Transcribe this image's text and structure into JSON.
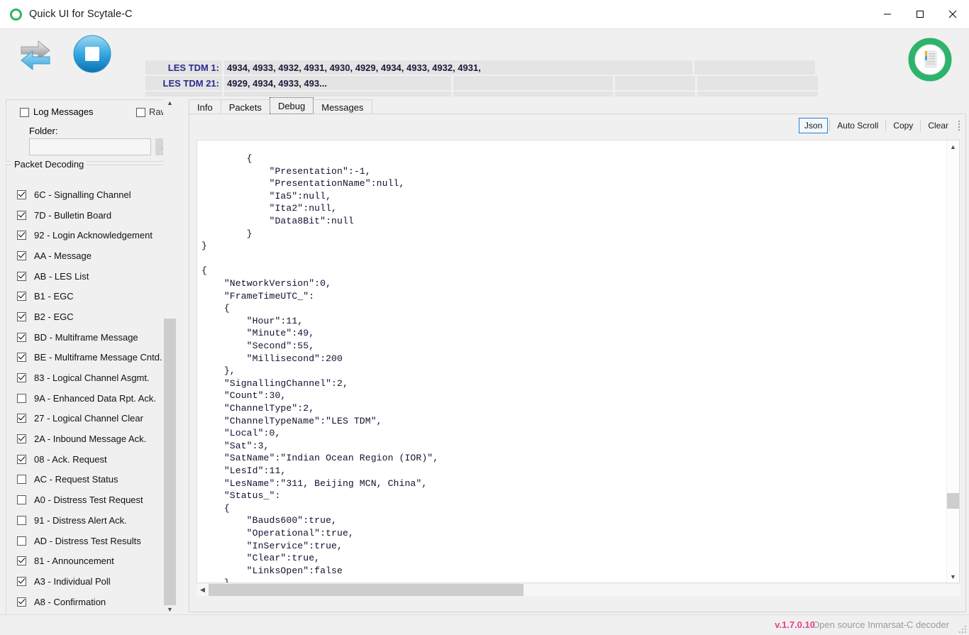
{
  "window": {
    "title": "Quick UI for Scytale-C",
    "logo_icon": "green-circle-icon",
    "minimize_label": "—",
    "maximize_label": "□",
    "close_label": "✕"
  },
  "toolbar": {
    "exchange_icon": "exchange-arrows-icon",
    "stop_icon": "stop-button-icon",
    "status_icon": "document-status-icon"
  },
  "status_grid": {
    "rows": [
      {
        "label": "LES TDM 1:",
        "value": "4934, 4933, 4932, 4931, 4930, 4929, 4934, 4933, 4932, 4931,"
      },
      {
        "label": "LES TDM 21:",
        "value": "4929, 4934, 4933, 493..."
      },
      {
        "label": "",
        "value": ""
      },
      {
        "label": "",
        "value": ""
      }
    ]
  },
  "left_panel": {
    "log_messages": {
      "label": "Log Messages",
      "checked": false
    },
    "raw": {
      "label": "Raw",
      "checked": false
    },
    "folder_label": "Folder:",
    "folder_value": "",
    "folder_placeholder": "",
    "browse_label": "...",
    "packet_decoding_title": "Packet Decoding",
    "packets": [
      {
        "label": "6C - Signalling Channel",
        "checked": true
      },
      {
        "label": "7D - Bulletin Board",
        "checked": true
      },
      {
        "label": "92 - Login Acknowledgement",
        "checked": true
      },
      {
        "label": "AA - Message",
        "checked": true
      },
      {
        "label": "AB - LES List",
        "checked": true
      },
      {
        "label": "B1 - EGC",
        "checked": true
      },
      {
        "label": "B2 - EGC",
        "checked": true
      },
      {
        "label": "BD - Multiframe Message",
        "checked": true
      },
      {
        "label": "BE - Multiframe Message Cntd.",
        "checked": true
      },
      {
        "label": "83 - Logical Channel Asgmt.",
        "checked": true
      },
      {
        "label": "9A - Enhanced Data Rpt. Ack.",
        "checked": false
      },
      {
        "label": "27 - Logical Channel Clear",
        "checked": true
      },
      {
        "label": "2A - Inbound Message Ack.",
        "checked": true
      },
      {
        "label": "08 - Ack. Request",
        "checked": true
      },
      {
        "label": "AC - Request Status",
        "checked": false
      },
      {
        "label": "A0 - Distress Test Request",
        "checked": false
      },
      {
        "label": "91 - Distress Alert Ack.",
        "checked": false
      },
      {
        "label": "AD - Distress Test Results",
        "checked": false
      },
      {
        "label": "81 - Announcement",
        "checked": true
      },
      {
        "label": "A3 - Individual Poll",
        "checked": true
      },
      {
        "label": "A8 - Confirmation",
        "checked": true
      }
    ]
  },
  "tabs": [
    {
      "label": "Info",
      "active": false
    },
    {
      "label": "Packets",
      "active": false
    },
    {
      "label": "Debug",
      "active": true
    },
    {
      "label": "Messages",
      "active": false
    }
  ],
  "debug_toolbar": {
    "json_label": "Json",
    "auto_scroll_label": "Auto Scroll",
    "copy_label": "Copy",
    "clear_label": "Clear",
    "grip_icon": "drag-grip-icon"
  },
  "debug_output": "        {\n            \"Presentation\":-1,\n            \"PresentationName\":null,\n            \"Ia5\":null,\n            \"Ita2\":null,\n            \"Data8Bit\":null\n        }\n}\n\n{\n    \"NetworkVersion\":0,\n    \"FrameTimeUTC_\":\n    {\n        \"Hour\":11,\n        \"Minute\":49,\n        \"Second\":55,\n        \"Millisecond\":200\n    },\n    \"SignallingChannel\":2,\n    \"Count\":30,\n    \"ChannelType\":2,\n    \"ChannelTypeName\":\"LES TDM\",\n    \"Local\":0,\n    \"Sat\":3,\n    \"SatName\":\"Indian Ocean Region (IOR)\",\n    \"LesId\":11,\n    \"LesName\":\"311, Beijing MCN, China\",\n    \"Status_\":\n    {\n        \"Bauds600\":true,\n        \"Operational\":true,\n        \"InService\":true,\n        \"Clear\":true,\n        \"LinksOpen\":false\n    },\n    \"Services_\":\n    {",
  "statusbar": {
    "version": "v.1.7.0.10",
    "tagline": "Open source Inmarsat-C decoder",
    "grip_icon": "resize-grip-icon"
  },
  "colors": {
    "accent_green": "#2eb36b",
    "version_pink": "#ea3d8c",
    "label_blue": "#2b2b8f",
    "selected_border": "#2a7fd4"
  }
}
